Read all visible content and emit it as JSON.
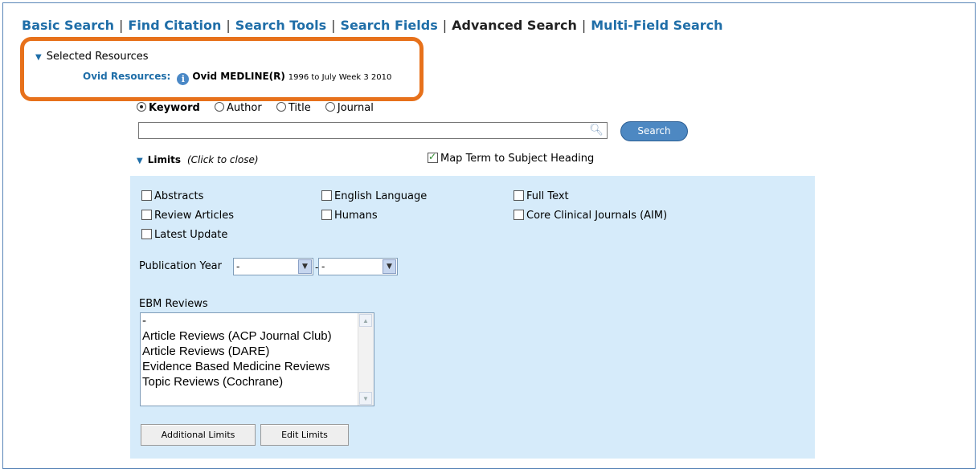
{
  "tabs": [
    {
      "label": "Basic Search"
    },
    {
      "label": "Find Citation"
    },
    {
      "label": "Search Tools"
    },
    {
      "label": "Search Fields"
    },
    {
      "label": "Advanced Search",
      "active": true
    },
    {
      "label": "Multi-Field Search"
    }
  ],
  "resources": {
    "toggle_label": "Selected Resources",
    "label": "Ovid Resources:",
    "database": "Ovid MEDLINE(R)",
    "coverage": "1996 to July Week 3 2010"
  },
  "search_mode": {
    "options": [
      "Keyword",
      "Author",
      "Title",
      "Journal"
    ],
    "selected": "Keyword"
  },
  "search": {
    "value": "",
    "button_label": "Search"
  },
  "limits": {
    "title": "Limits",
    "hint": "(Click to close)",
    "map_term": {
      "label": "Map Term to Subject Heading",
      "checked": true
    },
    "checkboxes": {
      "abstracts": "Abstracts",
      "review_articles": "Review Articles",
      "latest_update": "Latest Update",
      "english_language": "English Language",
      "humans": "Humans",
      "full_text": "Full Text",
      "core_clinical": "Core Clinical Journals (AIM)"
    },
    "publication_year": {
      "label": "Publication Year",
      "from": "-",
      "separator": "-",
      "to": "-"
    },
    "ebm": {
      "label": "EBM Reviews",
      "options": [
        "-",
        "Article Reviews (ACP Journal Club)",
        "Article Reviews (DARE)",
        "Evidence Based Medicine Reviews",
        "Topic Reviews (Cochrane)"
      ]
    },
    "buttons": {
      "additional": "Additional Limits",
      "edit": "Edit Limits"
    }
  },
  "colors": {
    "accent": "#1f6ea8",
    "highlight": "#e7711b",
    "panel": "#d6ebfa"
  }
}
